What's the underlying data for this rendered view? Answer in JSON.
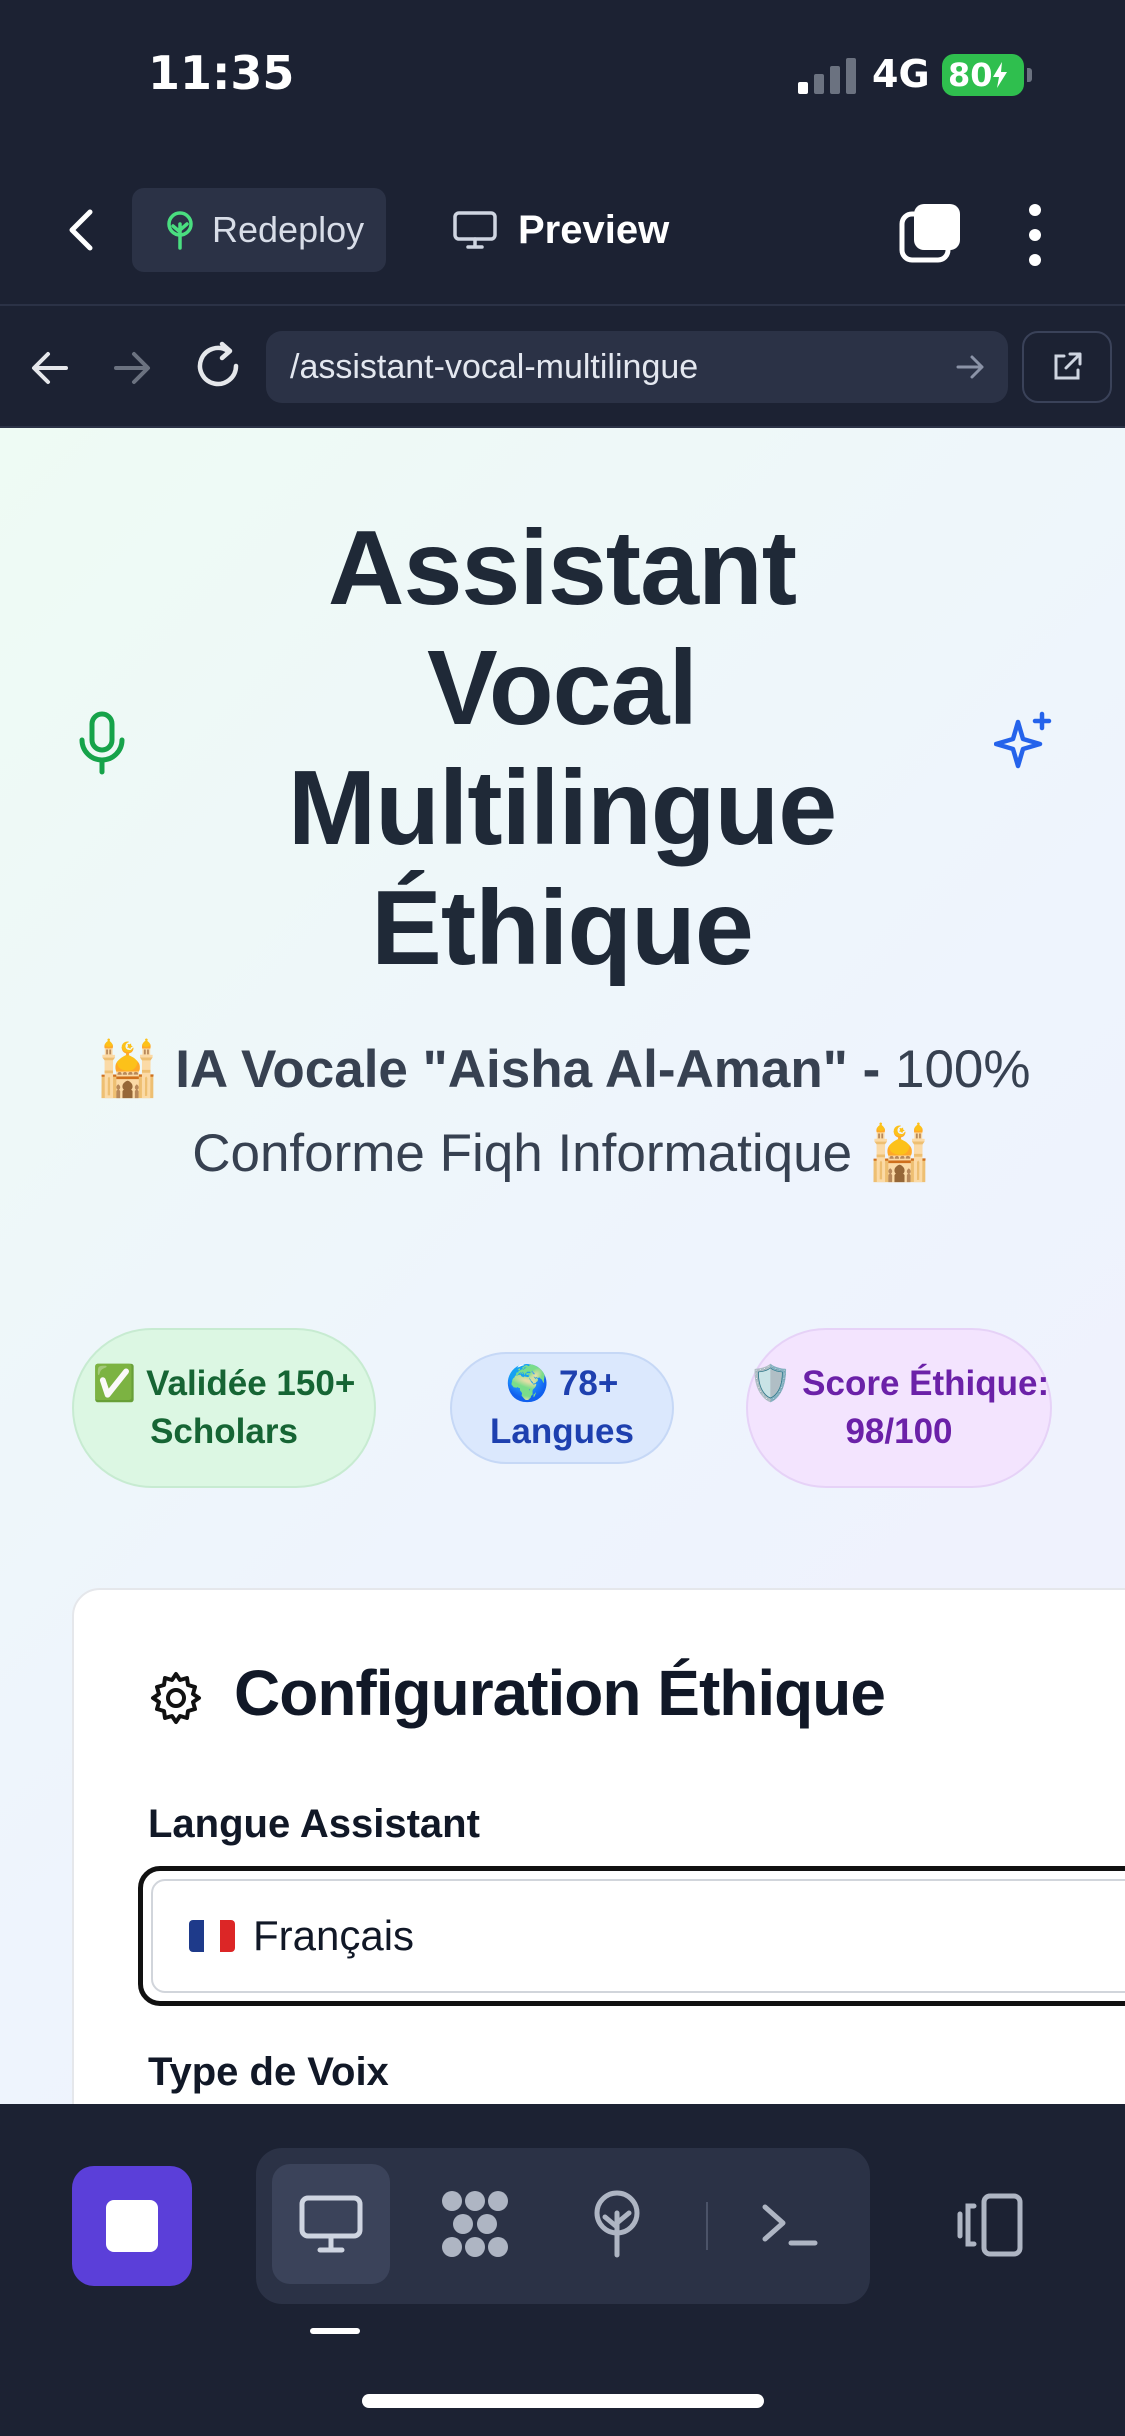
{
  "status_bar": {
    "time": "11:35",
    "network": "4G",
    "battery": "80"
  },
  "toolbar": {
    "redeploy_label": "Redeploy",
    "preview_label": "Preview"
  },
  "url_bar": {
    "url": "/assistant-vocal-multilingue"
  },
  "page": {
    "title_lines": [
      "Assistant",
      "Vocal",
      "Multilingue",
      "Éthique"
    ],
    "subtitle_emoji": "🕌",
    "subtitle_bold": "IA Vocale \"Aisha Al-Aman\" -",
    "subtitle_rest": "100% Conforme Fiqh Informatique",
    "badges": {
      "scholars": {
        "emoji": "✅",
        "text": "Validée 150+ Scholars"
      },
      "languages": {
        "emoji": "🌍",
        "text": "78+ Langues"
      },
      "score": {
        "emoji": "🛡️",
        "text": "Score Éthique: 98/100"
      }
    },
    "config_card": {
      "title": "Configuration Éthique",
      "language_label": "Langue Assistant",
      "language_value": "Français",
      "voice_label": "Type de Voix"
    }
  },
  "colors": {
    "dock_stop_button": "#5b3fd9",
    "background_dark": "#1c2233",
    "battery_green": "#2fbf4e"
  }
}
